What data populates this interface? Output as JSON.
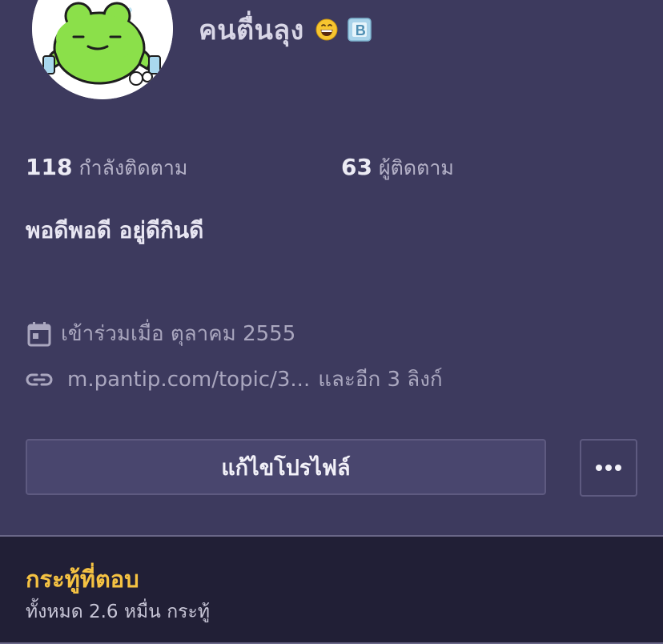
{
  "profile": {
    "display_name": "คนตื่นลุง",
    "name_emoji": "grinning-face-icon",
    "badge": "blogger-badge-icon",
    "bio": "พอดีพอดี อยู่ดีกินดี"
  },
  "stats": {
    "following_count": "118",
    "following_label": "กำลังติดตาม",
    "followers_count": "63",
    "followers_label": "ผู้ติดตาม"
  },
  "meta": {
    "joined_text": "เข้าร่วมเมื่อ ตุลาคม 2555",
    "link_text": "m.pantip.com/topic/3...",
    "link_more_text": "และอีก 3 ลิงก์"
  },
  "actions": {
    "edit_profile_label": "แก้ไขโปรไฟล์",
    "more_icon": "more-horizontal-icon"
  },
  "replies": {
    "title": "กระทู้ที่ตอบ",
    "count_text": "ทั้งหมด 2.6 หมื่น กระทู้"
  },
  "colors": {
    "background": "#3d3a5e",
    "section_dark": "#211f36",
    "accent_yellow": "#f5c242",
    "button_fill": "#49466e"
  }
}
